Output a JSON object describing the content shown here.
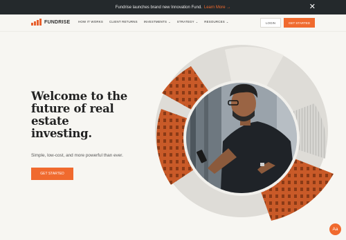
{
  "banner": {
    "text": "Fundrise launches brand new Innovation Fund.",
    "link": "Learn More →",
    "close": "✕"
  },
  "nav": {
    "logo": "FUNDRISE",
    "links": [
      {
        "label": "HOW IT WORKS",
        "dropdown": false
      },
      {
        "label": "CLIENT RETURNS",
        "dropdown": false
      },
      {
        "label": "INVESTMENTS",
        "dropdown": true
      },
      {
        "label": "STRATEGY",
        "dropdown": true
      },
      {
        "label": "RESOURCES",
        "dropdown": true
      }
    ],
    "chevron": "⌄",
    "login": "LOGIN",
    "get_started": "GET STARTED"
  },
  "hero": {
    "title_lines": [
      "Welcome to the",
      "future of real",
      "estate",
      "investing."
    ],
    "subtitle": "Simple, low-cost, and more powerful than ever.",
    "cta": "GET STARTED"
  },
  "accessibility_button": "Aa",
  "colors": {
    "accent": "#f06a2e",
    "banner_bg": "#24292c",
    "page_bg": "#f7f6f2"
  }
}
